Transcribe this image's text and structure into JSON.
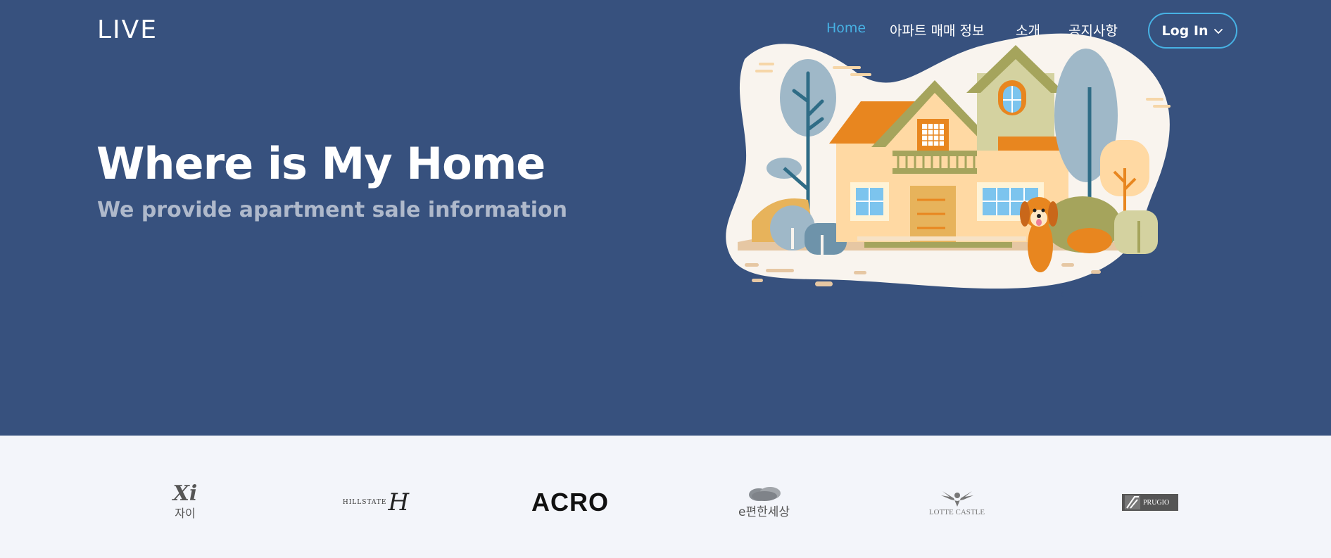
{
  "header": {
    "logo_text": "LIVE",
    "nav": [
      {
        "label": "Home",
        "active": true
      },
      {
        "label": "아파트 매매 정보",
        "active": false
      },
      {
        "label": "소개",
        "active": false
      },
      {
        "label": "공지사항",
        "active": false
      }
    ],
    "login_label": "Log In"
  },
  "hero": {
    "title": "Where is My Home",
    "subtitle": "We provide apartment sale information"
  },
  "brands": {
    "xi_mark": "Xi",
    "xi_label": "자이",
    "hillstate_text": "HILLSTATE",
    "hillstate_mark": "H",
    "acro": "ACRO",
    "epyeonhan": "e편한세상",
    "lotte": "LOTTE CASTLE",
    "prugio": "PRUGIO"
  },
  "colors": {
    "hero_bg": "#37517e",
    "accent": "#47b2e4",
    "brand_bg": "#f3f5fa"
  }
}
